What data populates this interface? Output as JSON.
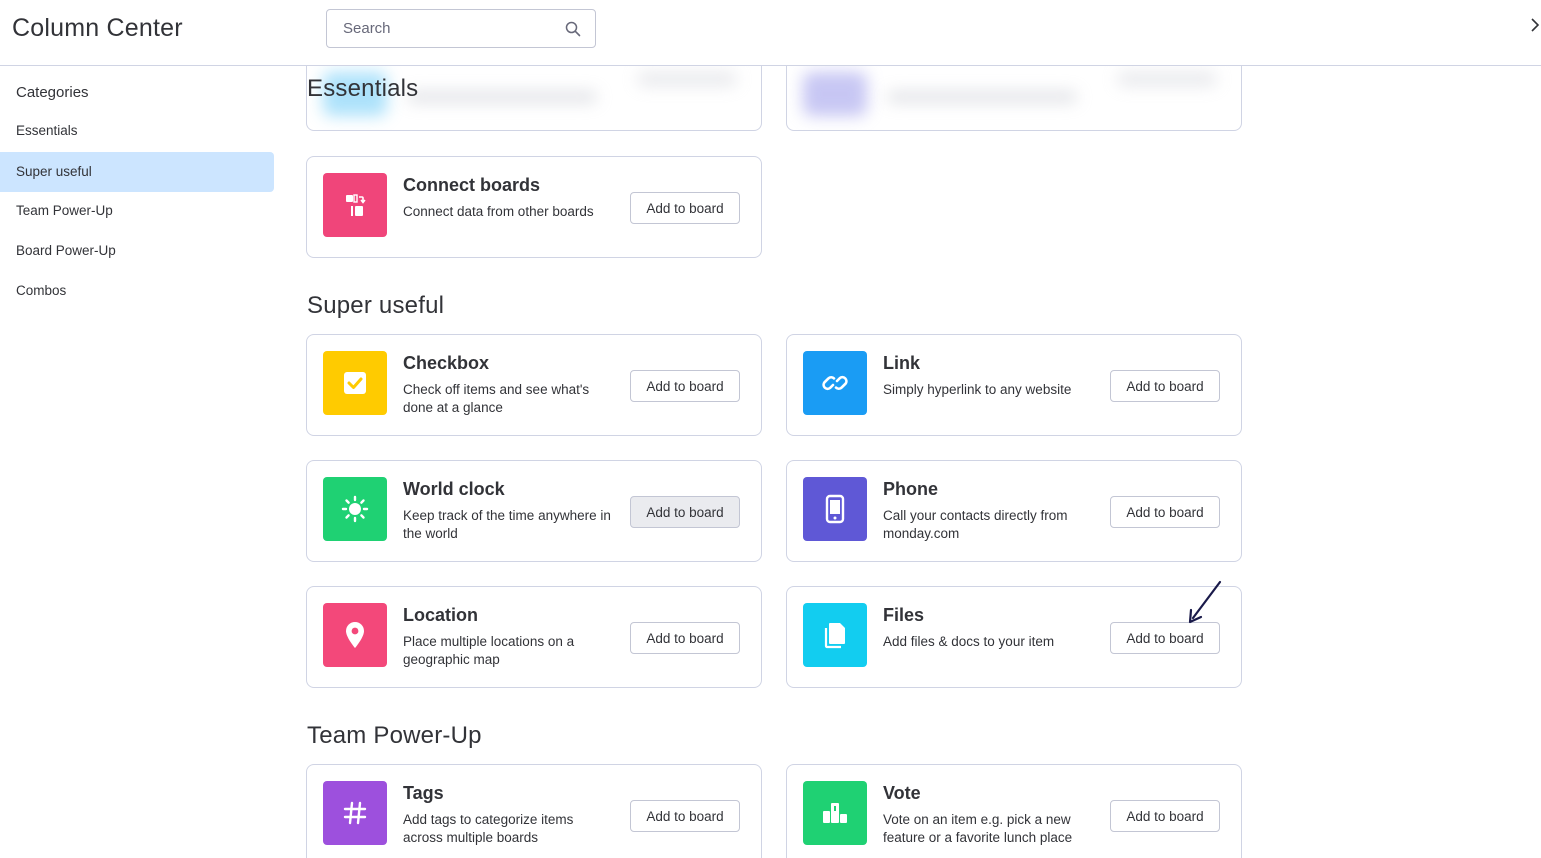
{
  "header": {
    "title": "Column Center",
    "search_placeholder": "Search"
  },
  "sidebar": {
    "heading": "Categories",
    "items": [
      {
        "label": "Essentials",
        "active": false
      },
      {
        "label": "Super useful",
        "active": true
      },
      {
        "label": "Team Power-Up",
        "active": false
      },
      {
        "label": "Board Power-Up",
        "active": false
      },
      {
        "label": "Combos",
        "active": false
      }
    ]
  },
  "sections": {
    "essentials": {
      "title": "Essentials",
      "cards": [
        {
          "title": "Connect boards",
          "desc": "Connect data from other boards",
          "button": "Add to board",
          "icon": "connect-boards-icon",
          "color": "#f0457a"
        }
      ]
    },
    "super_useful": {
      "title": "Super useful",
      "cards": [
        {
          "title": "Checkbox",
          "desc": "Check off items and see what's done at a glance",
          "button": "Add to board",
          "icon": "checkbox-icon",
          "color": "#ffcb00"
        },
        {
          "title": "Link",
          "desc": "Simply hyperlink to any website",
          "button": "Add to board",
          "icon": "link-icon",
          "color": "#1a9cf4"
        },
        {
          "title": "World clock",
          "desc": "Keep track of the time anywhere in the world",
          "button": "Add to board",
          "icon": "world-clock-icon",
          "color": "#1fd173"
        },
        {
          "title": "Phone",
          "desc": "Call your contacts directly from monday.com",
          "button": "Add to board",
          "icon": "phone-icon",
          "color": "#5f58d6"
        },
        {
          "title": "Location",
          "desc": "Place multiple locations on a geographic map",
          "button": "Add to board",
          "icon": "location-pin-icon",
          "color": "#f3487a"
        },
        {
          "title": "Files",
          "desc": "Add files & docs to your item",
          "button": "Add to board",
          "icon": "files-icon",
          "color": "#12cdf0"
        }
      ]
    },
    "team_power_up": {
      "title": "Team Power-Up",
      "cards": [
        {
          "title": "Tags",
          "desc": "Add tags to categorize items across multiple boards",
          "button": "Add to board",
          "icon": "hashtag-icon",
          "color": "#9d50dd"
        },
        {
          "title": "Vote",
          "desc": "Vote on an item e.g. pick a new feature or a favorite lunch place",
          "button": "Add to board",
          "icon": "vote-podium-icon",
          "color": "#1fd173"
        }
      ]
    }
  }
}
